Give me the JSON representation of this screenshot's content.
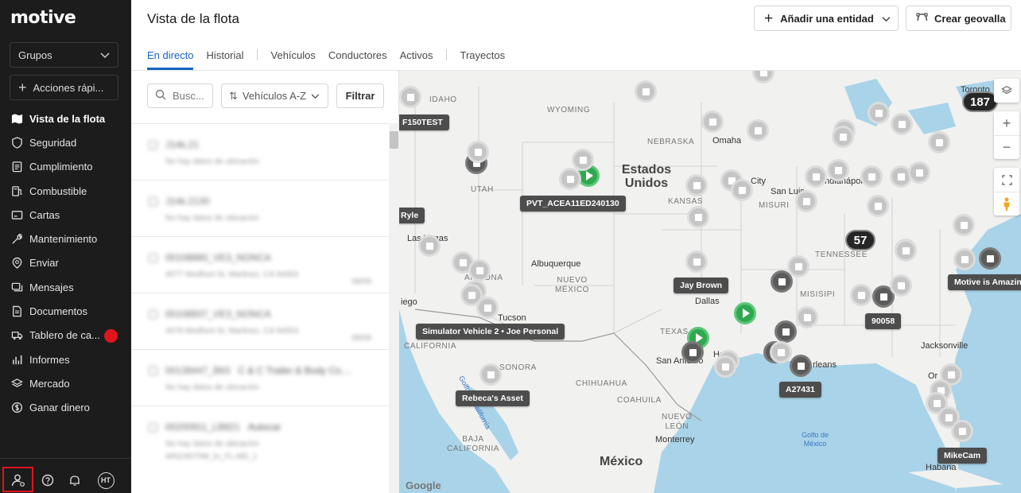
{
  "sidebar": {
    "logo": "motive",
    "groups_select": "Grupos",
    "quick_actions": "Acciones rápi...",
    "items": [
      {
        "label": "Vista de la flota",
        "icon": "map-icon",
        "active": true
      },
      {
        "label": "Seguridad",
        "icon": "shield-icon"
      },
      {
        "label": "Cumplimiento",
        "icon": "clipboard-icon"
      },
      {
        "label": "Combustible",
        "icon": "fuel-icon"
      },
      {
        "label": "Cartas",
        "icon": "card-icon"
      },
      {
        "label": "Mantenimiento",
        "icon": "wrench-icon"
      },
      {
        "label": "Enviar",
        "icon": "dispatch-icon"
      },
      {
        "label": "Mensajes",
        "icon": "message-icon"
      },
      {
        "label": "Documentos",
        "icon": "document-icon"
      },
      {
        "label": "Tablero de ca...",
        "icon": "truck-icon",
        "badge": true
      },
      {
        "label": "Informes",
        "icon": "chart-icon"
      },
      {
        "label": "Mercado",
        "icon": "layers-icon"
      },
      {
        "label": "Ganar dinero",
        "icon": "dollar-icon"
      }
    ],
    "bottom": {
      "avatar_initials": "HT"
    }
  },
  "header": {
    "title": "Vista de la flota",
    "add_entity": "Añadir una entidad",
    "create_geofence": "Crear geovalla",
    "tabs": [
      "En directo",
      "Historial",
      "Vehículos",
      "Conductores",
      "Activos",
      "Trayectos"
    ]
  },
  "list": {
    "search_placeholder": "Busc...",
    "sort_label": "Vehículos A-Z",
    "filter_label": "Filtrar",
    "rows": [
      {
        "title": "J14k.21",
        "sub": "",
        "line2": "No hay datos de ubicación",
        "time": ""
      },
      {
        "title": "J14k.2130",
        "sub": "",
        "line2": "No hay datos de ubicación",
        "time": ""
      },
      {
        "title": "00108880_VE3_NONCA",
        "sub": "",
        "line2": "4077 Medford St, Martinez, CA 94553",
        "time": "08/09"
      },
      {
        "title": "00108937_VE3_NONCA",
        "sub": "",
        "line2": "4078 Medford St, Martinez, CA 94553",
        "time": "08/09"
      },
      {
        "title": "00138447_B63",
        "sub": "C & C Trailer & Body Co....",
        "line2": "No hay datos de ubicación",
        "time": ""
      },
      {
        "title": "00200911_LB821",
        "sub": "Autocar",
        "line2": "No hay datos de ubicación",
        "time": ""
      }
    ],
    "row6_extra": "ARIZ4D70M_to_FL.MD_1"
  },
  "map": {
    "country_us": "Estados Unidos",
    "country_mx": "México",
    "gulf": "Golfo de México",
    "clusters": [
      "187",
      "57"
    ],
    "tags": [
      "F150TEST",
      "PVT_ACEA11ED240130",
      "Ryle",
      "Jay Brown",
      "Simulator Vehicle 2 • Joe Personal",
      "Rebeca's Asset",
      "90058",
      "A27431",
      "Motive is Amazin",
      "MikeCam"
    ],
    "labels": {
      "idaho": "IDAHO",
      "wyoming": "WYOMING",
      "utah": "UTAH",
      "nebraska": "NEBRASKA",
      "kansas": "KANSAS",
      "misuri": "MISURI",
      "arizona": "ARIZONA",
      "nuevo_mexico": "NUEVO\nMÉXICO",
      "texas": "TEXAS",
      "tennessee": "TENNESSEE",
      "misisipi": "MISISIPI",
      "california": "CALIFORNIA",
      "baja": "BAJA\nCALIFORNIA",
      "sonora": "SONORA",
      "chihuahua": "CHIHUAHUA",
      "coahuila": "COAHUILA",
      "nuevo_leon": "NUEVO\nLEÓN",
      "omaha": "Omaha",
      "city": "City",
      "san_luis": "San Luis",
      "indianapolis": "Indianápolis",
      "las_vegas": "Las Vegas",
      "albuquerque": "Albuquerque",
      "tucson": "Tucson",
      "diego": "iego",
      "dallas": "Dallas",
      "san_antonio": "San Antonio",
      "houston": "Ho",
      "orleans": "rleans",
      "jacksonville": "Jacksonville",
      "orlando": "Or",
      "monterrey": "Monterrey",
      "toronto": "Toronto",
      "habana": "Habana",
      "golfo_california": "Golfo de California",
      "google": "Google"
    }
  }
}
